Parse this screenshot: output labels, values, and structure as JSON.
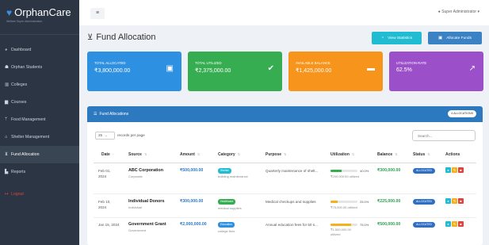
{
  "sidebar": {
    "brand_name": "OrphanCare",
    "brand_tagline": "Welfare Super Administration",
    "brand_icon": "heart-icon",
    "items": [
      {
        "label": "Dashboard",
        "icon": "dashboard-icon"
      },
      {
        "label": "Orphan Students",
        "icon": "users-icon"
      },
      {
        "label": "Colleges",
        "icon": "building-icon"
      },
      {
        "label": "Courses",
        "icon": "book-icon"
      },
      {
        "label": "Food Management",
        "icon": "utensils-icon"
      },
      {
        "label": "Shelter Management",
        "icon": "home-icon"
      },
      {
        "label": "Fund Allocation",
        "icon": "hand-coin-icon"
      },
      {
        "label": "Reports",
        "icon": "chart-icon"
      }
    ],
    "logout_label": "Logout",
    "active_item": "Fund Allocation"
  },
  "topbar": {
    "menu_icon": "hamburger-icon",
    "user_label": "Super Administrator ▾",
    "user_icon": "user-icon"
  },
  "header": {
    "title": "Fund Allocation",
    "title_icon": "hand-coin-icon",
    "view_stats_label": "View Statistics",
    "allocate_label": "Allocate Funds"
  },
  "cards": [
    {
      "label": "TOTAL ALLOCATED",
      "value": "₹3,800,000.00",
      "icon": "wallet-icon",
      "color": "#2e90e0"
    },
    {
      "label": "TOTAL UTILIZED",
      "value": "₹2,375,000.00",
      "icon": "check-circle-icon",
      "color": "#35ad50"
    },
    {
      "label": "AVAILABLE BALANCE",
      "value": "₹1,425,000.00",
      "icon": "card-icon",
      "color": "#f6941c"
    },
    {
      "label": "UTILIZATION RATE",
      "value": "62.5%",
      "icon": "trend-chart-icon",
      "color": "#9b4fc9"
    }
  ],
  "panel": {
    "title": "Fund Allocations",
    "count_badge": "4 ALLOCATIONS",
    "page_length": "25",
    "length_label": "records per page",
    "search_placeholder": "Search..."
  },
  "table": {
    "columns": [
      "Date",
      "Source",
      "Amount",
      "Category",
      "Purpose",
      "Utilization",
      "Balance",
      "Status",
      "Actions"
    ],
    "rows": [
      {
        "date_line1": "Feb 01,",
        "date_line2": "2024",
        "source": "ABC Corporation",
        "source_type": "Corporate",
        "amount": "₹500,000.00",
        "category": "Shelter",
        "category_detail": "building maintenance",
        "purpose": "Quarterly maintenance of shelt...",
        "utilization": 0.4,
        "utilization_pct": "40.0%",
        "utilized_text": "₹200,000.00 utilized",
        "balance": "₹300,000.00",
        "status": "ALLOCATED"
      },
      {
        "date_line1": "Feb 10,",
        "date_line2": "2024",
        "source": "Individual Donors",
        "source_type": "Individual",
        "amount": "₹300,000.00",
        "category": "Healthcare",
        "category_detail": "medical supplies",
        "purpose": "Medical checkups and supplies",
        "utilization": 0.25,
        "utilization_pct": "25.0%",
        "utilized_text": "₹75,000.00 utilized",
        "balance": "₹225,000.00",
        "status": "ALLOCATED"
      },
      {
        "date_line1": "Jan 15, 2024",
        "date_line2": "",
        "source": "Government Grant",
        "source_type": "Government",
        "amount": "₹2,000,000.00",
        "category": "Education",
        "category_detail": "college fees",
        "purpose": "Annual education fees for 50 s...",
        "utilization": 0.75,
        "utilization_pct": "75.0%",
        "utilized_text": "₹1,500,000.00 utilized",
        "balance": "₹500,000.00",
        "status": "ALLOCATED"
      }
    ],
    "bar_colors": [
      "#35ad50",
      "#f6b01c",
      "#f6b01c"
    ]
  }
}
